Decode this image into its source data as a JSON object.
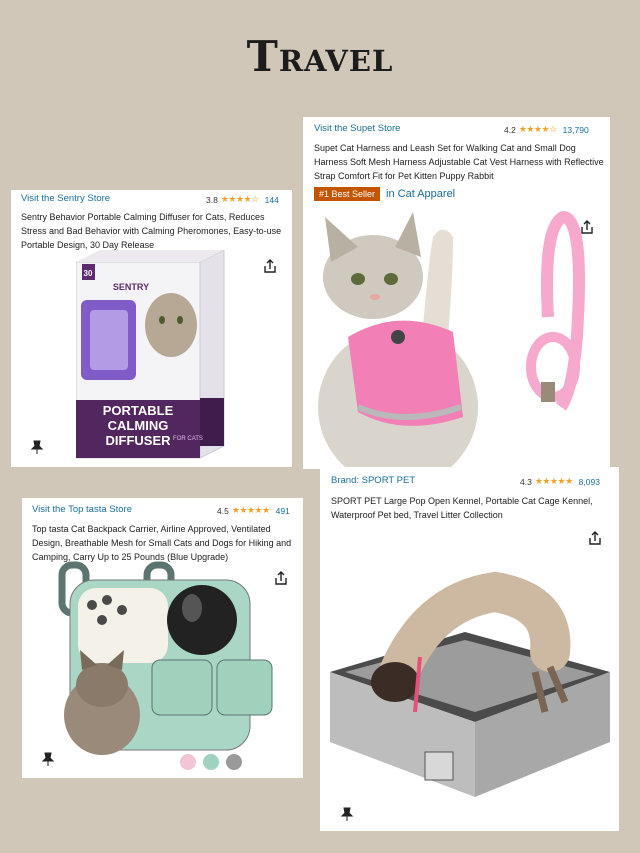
{
  "page": {
    "title": "Travel"
  },
  "cards": {
    "diffuser": {
      "store": "Visit the Sentry Store",
      "rating": "3.8",
      "stars": "★★★★☆",
      "reviews": "144",
      "description": "Sentry Behavior Portable Calming Diffuser for Cats, Reduces Stress and Bad Behavior with Calming Pheromones, Easy-to-use Portable Design, 30 Day Release",
      "box_brand": "SENTRY",
      "box_side": "PORTABLE CALMING DIFFUSER",
      "box_title_1": "PORTABLE",
      "box_title_2": "CALMING",
      "box_title_3": "DIFFUSER",
      "box_cats": "FOR CATS",
      "box_days": "30"
    },
    "harness": {
      "store": "Visit the Supet Store",
      "rating": "4.2",
      "stars": "★★★★☆",
      "reviews": "13,790",
      "description": "Supet Cat Harness and Leash Set for Walking Cat and Small Dog Harness Soft Mesh Harness Adjustable Cat Vest Harness with Reflective Strap Comfort Fit for Pet Kitten Puppy Rabbit",
      "badge": "#1 Best Seller",
      "category": "in Cat Apparel"
    },
    "backpack": {
      "store": "Visit the Top tasta Store",
      "rating": "4.5",
      "stars": "★★★★★",
      "reviews": "491",
      "description": "Top tasta Cat Backpack Carrier, Airline Approved, Ventilated Design, Breathable Mesh for Small Cats and Dogs for Hiking and Camping, Carry Up to 25 Pounds (Blue Upgrade)",
      "swatch_colors": [
        "#f2c4d6",
        "#9fd3c0",
        "#9a9a9a"
      ]
    },
    "kennel": {
      "store": "Brand: SPORT PET",
      "rating": "4.3",
      "stars": "★★★★★",
      "reviews": "8,093",
      "description": "SPORT PET Large Pop Open Kennel, Portable Cat Cage Kennel, Waterproof Pet bed, Travel Litter Collection"
    }
  },
  "colors": {
    "background": "#d1c7b8",
    "link": "#1a6e9c",
    "star": "#f1a22a",
    "bestseller": "#c45500"
  }
}
